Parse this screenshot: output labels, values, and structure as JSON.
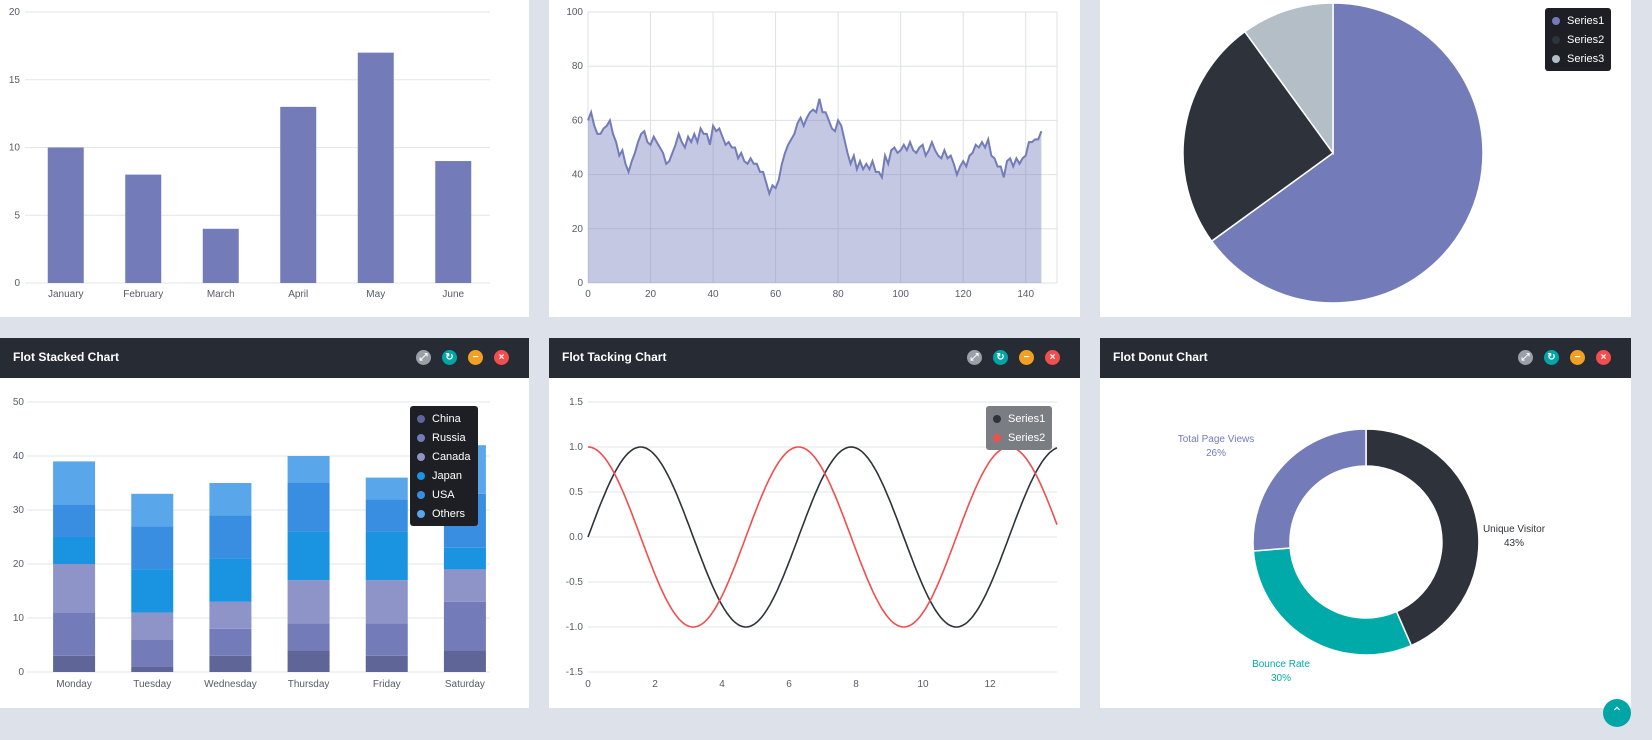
{
  "colors": {
    "purple": "#737cb9",
    "dark": "#2e333b",
    "grey": "#b3bec7",
    "teal": "#00aaa8",
    "red": "#f24e4e",
    "header": "#262b34"
  },
  "header_buttons": [
    {
      "icon": "expand-icon",
      "color": "#9aa0a8",
      "glyph": "⤢"
    },
    {
      "icon": "refresh-icon",
      "color": "#00a6a6",
      "glyph": "↻"
    },
    {
      "icon": "minimize-icon",
      "color": "#f2a024",
      "glyph": "−"
    },
    {
      "icon": "close-icon",
      "color": "#f24e4e",
      "glyph": "×"
    }
  ],
  "panels": {
    "stacked": {
      "title": "Flot Stacked Chart"
    },
    "tracking": {
      "title": "Flot Tacking Chart"
    },
    "donut": {
      "title": "Flot Donut Chart"
    }
  },
  "scroll_top": {
    "glyph": "⌃"
  },
  "chart_data": [
    {
      "type": "bar",
      "categories": [
        "January",
        "February",
        "March",
        "April",
        "May",
        "June"
      ],
      "values": [
        10,
        8,
        4,
        13,
        17,
        9
      ],
      "ylim": [
        0,
        20
      ],
      "yticks": [
        0,
        5,
        10,
        15,
        20
      ],
      "grid": true
    },
    {
      "type": "area",
      "xlim": [
        0,
        150
      ],
      "ylim": [
        0,
        100
      ],
      "xticks": [
        0,
        20,
        40,
        60,
        80,
        100,
        120,
        140
      ],
      "yticks": [
        0,
        20,
        40,
        60,
        80,
        100
      ],
      "grid": true,
      "points": [
        [
          0,
          60
        ],
        [
          1,
          63
        ],
        [
          2,
          58
        ],
        [
          3,
          55
        ],
        [
          4,
          55
        ],
        [
          5,
          57
        ],
        [
          6,
          58
        ],
        [
          7,
          60
        ],
        [
          8,
          55
        ],
        [
          9,
          52
        ],
        [
          10,
          47
        ],
        [
          11,
          49
        ],
        [
          12,
          44
        ],
        [
          13,
          41
        ],
        [
          14,
          45
        ],
        [
          15,
          48
        ],
        [
          16,
          52
        ],
        [
          17,
          55
        ],
        [
          18,
          56
        ],
        [
          19,
          52
        ],
        [
          20,
          51
        ],
        [
          21,
          54
        ],
        [
          22,
          52
        ],
        [
          23,
          50
        ],
        [
          24,
          48
        ],
        [
          25,
          44
        ],
        [
          26,
          45
        ],
        [
          27,
          48
        ],
        [
          28,
          51
        ],
        [
          29,
          55
        ],
        [
          30,
          52
        ],
        [
          31,
          50
        ],
        [
          32,
          54
        ],
        [
          33,
          52
        ],
        [
          34,
          55
        ],
        [
          35,
          52
        ],
        [
          36,
          57
        ],
        [
          37,
          55
        ],
        [
          38,
          55
        ],
        [
          39,
          51
        ],
        [
          40,
          58
        ],
        [
          41,
          56
        ],
        [
          42,
          57
        ],
        [
          43,
          54
        ],
        [
          44,
          51
        ],
        [
          45,
          52
        ],
        [
          46,
          50
        ],
        [
          47,
          50
        ],
        [
          48,
          46
        ],
        [
          49,
          48
        ],
        [
          50,
          45
        ],
        [
          51,
          44
        ],
        [
          52,
          46
        ],
        [
          53,
          44
        ],
        [
          54,
          44
        ],
        [
          55,
          41
        ],
        [
          56,
          41
        ],
        [
          57,
          37
        ],
        [
          58,
          33
        ],
        [
          59,
          36
        ],
        [
          60,
          35
        ],
        [
          61,
          38
        ],
        [
          62,
          44
        ],
        [
          63,
          48
        ],
        [
          64,
          51
        ],
        [
          65,
          53
        ],
        [
          66,
          55
        ],
        [
          67,
          59
        ],
        [
          68,
          61
        ],
        [
          69,
          58
        ],
        [
          70,
          61
        ],
        [
          71,
          63
        ],
        [
          72,
          64
        ],
        [
          73,
          63
        ],
        [
          74,
          68
        ],
        [
          75,
          63
        ],
        [
          76,
          63
        ],
        [
          77,
          60
        ],
        [
          78,
          57
        ],
        [
          79,
          56
        ],
        [
          80,
          60
        ],
        [
          81,
          58
        ],
        [
          82,
          53
        ],
        [
          83,
          48
        ],
        [
          84,
          44
        ],
        [
          85,
          47
        ],
        [
          86,
          42
        ],
        [
          87,
          45
        ],
        [
          88,
          42
        ],
        [
          89,
          44
        ],
        [
          90,
          42
        ],
        [
          91,
          45
        ],
        [
          92,
          41
        ],
        [
          93,
          41
        ],
        [
          94,
          39
        ],
        [
          95,
          47
        ],
        [
          96,
          44
        ],
        [
          97,
          49
        ],
        [
          98,
          50
        ],
        [
          99,
          48
        ],
        [
          100,
          49
        ],
        [
          101,
          51
        ],
        [
          102,
          49
        ],
        [
          103,
          52
        ],
        [
          104,
          49
        ],
        [
          105,
          48
        ],
        [
          106,
          50
        ],
        [
          107,
          51
        ],
        [
          108,
          47
        ],
        [
          109,
          49
        ],
        [
          110,
          52
        ],
        [
          111,
          49
        ],
        [
          112,
          47
        ],
        [
          113,
          46
        ],
        [
          114,
          49
        ],
        [
          115,
          46
        ],
        [
          116,
          47
        ],
        [
          117,
          44
        ],
        [
          118,
          40
        ],
        [
          119,
          43
        ],
        [
          120,
          45
        ],
        [
          121,
          43
        ],
        [
          122,
          47
        ],
        [
          123,
          48
        ],
        [
          124,
          51
        ],
        [
          125,
          50
        ],
        [
          126,
          52
        ],
        [
          127,
          50
        ],
        [
          128,
          53
        ],
        [
          129,
          47
        ],
        [
          130,
          46
        ],
        [
          131,
          43
        ],
        [
          132,
          43
        ],
        [
          133,
          39
        ],
        [
          134,
          45
        ],
        [
          135,
          46
        ],
        [
          136,
          43
        ],
        [
          137,
          46
        ],
        [
          138,
          44
        ],
        [
          139,
          46
        ],
        [
          140,
          47
        ],
        [
          141,
          52
        ],
        [
          142,
          52
        ],
        [
          143,
          53
        ],
        [
          144,
          53
        ],
        [
          145,
          56
        ]
      ]
    },
    {
      "type": "pie",
      "labels": [
        "Series1",
        "Series2",
        "Series3"
      ],
      "values": [
        65,
        25,
        10
      ],
      "colors": [
        "#737cb9",
        "#2e333b",
        "#b3bec7"
      ],
      "legend": "top-right"
    },
    {
      "type": "bar",
      "stacked": true,
      "title": "Flot Stacked Chart",
      "categories": [
        "Monday",
        "Tuesday",
        "Wednesday",
        "Thursday",
        "Friday",
        "Saturday"
      ],
      "ylim": [
        0,
        50
      ],
      "yticks": [
        0,
        10,
        20,
        30,
        40,
        50
      ],
      "legend": "top-right",
      "series": [
        {
          "name": "China",
          "color": "#5f6597",
          "values": [
            3,
            1,
            3,
            4,
            3,
            4
          ]
        },
        {
          "name": "Russia",
          "color": "#737cb9",
          "values": [
            8,
            5,
            5,
            5,
            6,
            9
          ]
        },
        {
          "name": "Canada",
          "color": "#8e94c7",
          "values": [
            9,
            5,
            5,
            8,
            8,
            6
          ]
        },
        {
          "name": "Japan",
          "color": "#1a94e0",
          "values": [
            5,
            8,
            8,
            9,
            9,
            4
          ]
        },
        {
          "name": "USA",
          "color": "#3a8ee2",
          "values": [
            6,
            8,
            8,
            9,
            6,
            10
          ]
        },
        {
          "name": "Others",
          "color": "#5aa6ea",
          "values": [
            8,
            6,
            6,
            5,
            4,
            9
          ]
        }
      ]
    },
    {
      "type": "line",
      "title": "Flot Tacking Chart",
      "xlim": [
        0,
        14
      ],
      "ylim": [
        -1.5,
        1.5
      ],
      "xticks": [
        0,
        2,
        4,
        6,
        8,
        10,
        12
      ],
      "yticks": [
        "1.5",
        "1.0",
        "0.5",
        "0.0",
        "-0.5",
        "-1.0",
        "-1.5"
      ],
      "legend": "top-right",
      "series": [
        {
          "name": "Series1",
          "color": "#2e333b",
          "function": "sin(x)",
          "x": [
            0,
            1,
            2,
            3,
            4,
            5,
            6,
            7,
            8,
            9,
            10,
            11,
            12,
            13,
            14
          ],
          "values": [
            0,
            0.84,
            0.91,
            0.14,
            -0.76,
            -0.96,
            -0.28,
            0.66,
            0.99,
            0.41,
            -0.54,
            -1.0,
            -0.54,
            0.42,
            0.99
          ]
        },
        {
          "name": "Series2",
          "color": "#f24e4e",
          "function": "cos(x)",
          "x": [
            0,
            1,
            2,
            3,
            4,
            5,
            6,
            7,
            8,
            9,
            10,
            11,
            12,
            13,
            14
          ],
          "values": [
            1,
            0.54,
            -0.42,
            -0.99,
            -0.65,
            0.28,
            0.96,
            0.75,
            -0.15,
            -0.91,
            -0.84,
            0.0,
            0.84,
            0.91,
            0.14
          ]
        }
      ]
    },
    {
      "type": "pie",
      "subtype": "donut",
      "title": "Flot Donut Chart",
      "labels": [
        "Unique Visitor",
        "Bounce Rate",
        "Total Page Views"
      ],
      "values": [
        43,
        30,
        26
      ],
      "display": [
        "43%",
        "30%",
        "26%"
      ],
      "colors": [
        "#2e333b",
        "#00aaa8",
        "#737cb9"
      ]
    }
  ]
}
